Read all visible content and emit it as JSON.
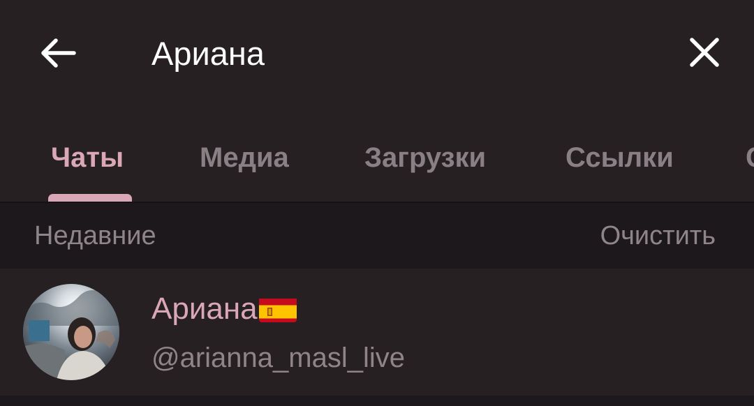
{
  "search": {
    "query": "Ариана"
  },
  "tabs": [
    {
      "label": "Чаты",
      "active": true
    },
    {
      "label": "Медиа",
      "active": false
    },
    {
      "label": "Загрузки",
      "active": false
    },
    {
      "label": "Ссылки",
      "active": false
    },
    {
      "label": "С",
      "active": false
    }
  ],
  "recent": {
    "title": "Недавние",
    "clear_label": "Очистить"
  },
  "results": [
    {
      "name": "Ариана",
      "flag": "spain-flag-icon",
      "username": "@arianna_masl_live"
    }
  ],
  "colors": {
    "background": "#272023",
    "accent": "#d9a7b6",
    "muted_text": "#8f8589",
    "header_band": "#1d181b"
  },
  "icons": {
    "back": "arrow-left-icon",
    "clear": "close-icon"
  }
}
